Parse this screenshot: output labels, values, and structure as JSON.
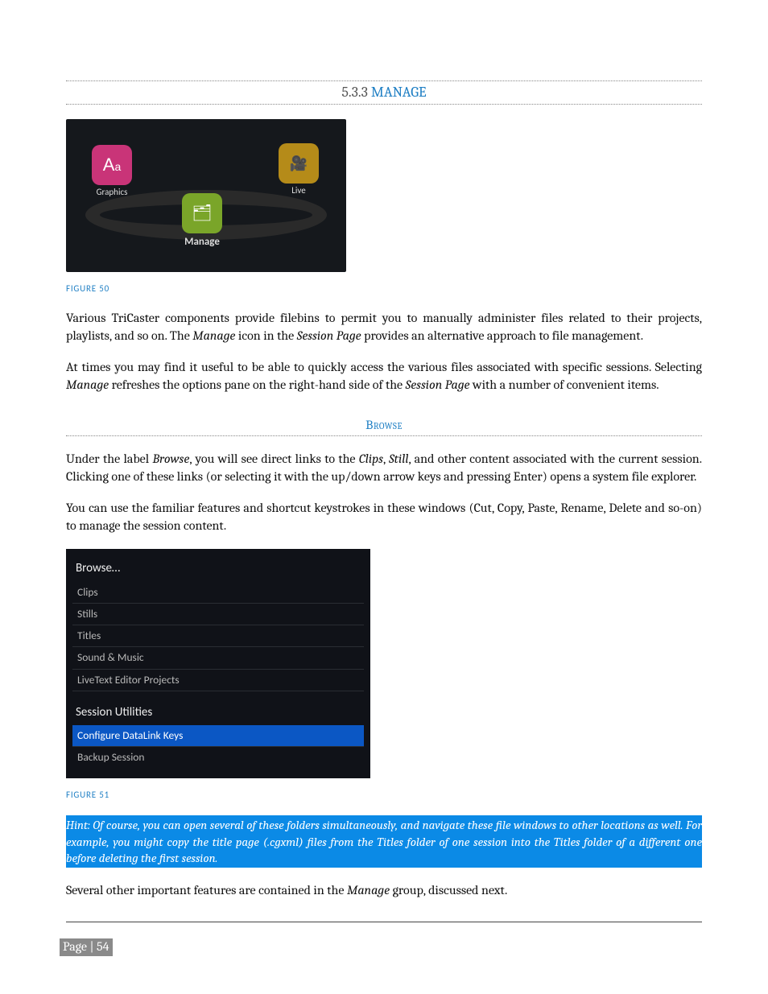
{
  "section": {
    "number": "5.3.3",
    "title": "MANAGE"
  },
  "figure1": {
    "caption": "FIGURE 50",
    "badges": {
      "graphics": "Graphics",
      "live": "Live",
      "manage": "Manage"
    }
  },
  "p1": "Various TriCaster components provide filebins to permit you to manually administer files related to their projects, playlists, and so on.  The ",
  "p1_i1": "Manage",
  "p1_b": " icon in the ",
  "p1_i2": "Session Page",
  "p1_c": " provides an alternative approach to file management.",
  "p2a": "At times you may find it useful to be able to quickly access the various files associated with specific sessions. Selecting ",
  "p2_i1": "Manage",
  "p2b": " refreshes the options pane on the right-hand side of the ",
  "p2_i2": "Session Page",
  "p2c": " with a number of convenient items.",
  "browse_heading": "Browse",
  "p3a": "Under the label ",
  "p3_i1": "Browse",
  "p3b": ", you will see direct links to the ",
  "p3_i2": "Clips",
  "p3c": ", ",
  "p3_i3": "Still",
  "p3d": ", and other content associated with the current session. Clicking one of these links (or selecting it with the up/down arrow keys and pressing Enter) opens a system file explorer.",
  "p4": "You can use the familiar features and shortcut keystrokes in these windows (Cut, Copy, Paste, Rename, Delete and so-on) to manage the session content.",
  "panel": {
    "browse_label": "Browse…",
    "items": [
      "Clips",
      "Stills",
      "Titles",
      "Sound & Music",
      "LiveText Editor Projects"
    ],
    "util_label": "Session Utilities",
    "util_items": [
      "Configure DataLink Keys",
      "Backup Session"
    ],
    "selected_util_index": 0
  },
  "figure2": {
    "caption": "FIGURE 51"
  },
  "hint": "Hint: Of course, you can open several of these folders simultaneously, and navigate these file windows to other locations as well. For example, you might copy the title page (.cgxml) files from the Titles folder of one session into the Titles folder of a different one before deleting the first session.",
  "p5a": "Several other important features are contained in the ",
  "p5_i1": "Manage",
  "p5b": " group, discussed next.",
  "footer": {
    "page_label": "Page | 54"
  }
}
